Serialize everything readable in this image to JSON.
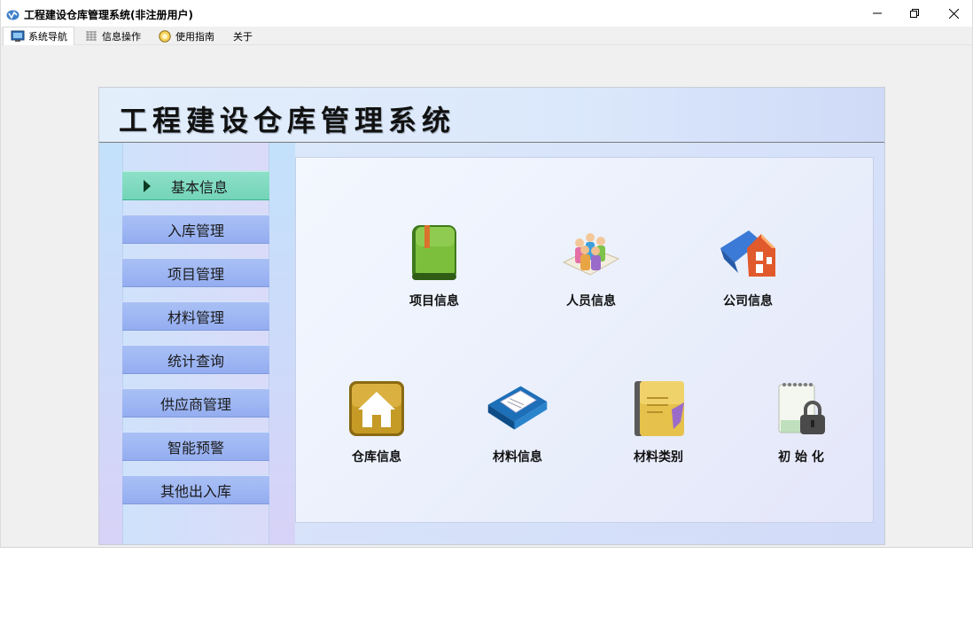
{
  "window": {
    "title": "工程建设仓库管理系统(非注册用户)",
    "controls": [
      "minimize",
      "restore",
      "close"
    ]
  },
  "menubar": {
    "items": [
      {
        "label": "系统导航",
        "icon": "monitor-icon"
      },
      {
        "label": "信息操作",
        "icon": "grid-icon"
      },
      {
        "label": "使用指南",
        "icon": "help-icon"
      },
      {
        "label": "关于",
        "icon": ""
      }
    ]
  },
  "banner": {
    "title": "工程建设仓库管理系统"
  },
  "sidebar": {
    "items": [
      {
        "label": "基本信息",
        "active": true
      },
      {
        "label": "入库管理"
      },
      {
        "label": "项目管理"
      },
      {
        "label": "材料管理"
      },
      {
        "label": "统计查询"
      },
      {
        "label": "供应商管理"
      },
      {
        "label": "智能预警"
      },
      {
        "label": "其他出入库"
      }
    ]
  },
  "tiles": [
    {
      "label": "项目信息",
      "icon": "green-book-icon"
    },
    {
      "label": "人员信息",
      "icon": "people-icon"
    },
    {
      "label": "公司信息",
      "icon": "company-house-icon"
    },
    {
      "label": "仓库信息",
      "icon": "warehouse-house-icon"
    },
    {
      "label": "材料信息",
      "icon": "material-book-icon"
    },
    {
      "label": "材料类别",
      "icon": "category-notebook-icon"
    },
    {
      "label": "初 始 化",
      "icon": "lock-notepad-icon"
    }
  ],
  "colors": {
    "nav_button": "#a3bbf4",
    "nav_active": "#7fdac0",
    "banner_bg": "#dbe8fb"
  }
}
